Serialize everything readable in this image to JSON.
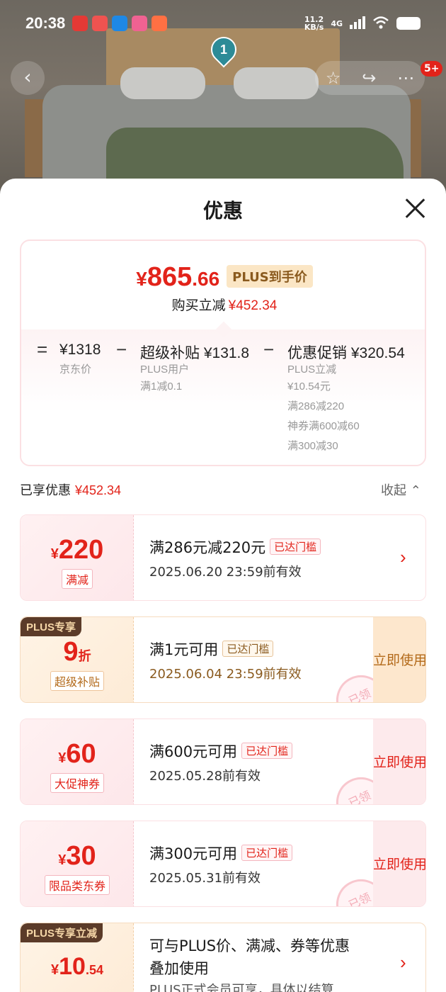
{
  "status_bar": {
    "time": "20:38",
    "net_speed_value": "11.2",
    "net_speed_unit": "KB/s",
    "network": "4G"
  },
  "header": {
    "location_pin": "1",
    "msg_badge": "5+"
  },
  "sheet": {
    "title": "优惠",
    "price": {
      "symbol": "¥",
      "integer": "865",
      "decimal": ".66",
      "plus_tag": "PLUS到手价",
      "buy_reduce_label": "购买立减",
      "buy_reduce_value": "¥452.34"
    },
    "breakdown": {
      "eq": "=",
      "minus": "−",
      "jd_price": {
        "value": "¥1318",
        "label": "京东价"
      },
      "super_subsidy": {
        "title": "超级补贴 ¥131.8",
        "lines": [
          "PLUS用户",
          "满1减0.1"
        ]
      },
      "promo": {
        "title": "优惠促销 ¥320.54",
        "lines": [
          "PLUS立减",
          "¥10.54元",
          "满286减220",
          "神券满600减60",
          "满300减30"
        ]
      }
    },
    "enjoyed": {
      "label": "已享优惠",
      "value": "¥452.34",
      "collapse": "收起"
    },
    "coupons": [
      {
        "symbol": "¥",
        "value": "220",
        "unit": "",
        "tag": "满减",
        "line1": "满286元减220元",
        "badge": "已达门槛",
        "line2": "2025.06.20 23:59前有效",
        "arrow": "›"
      },
      {
        "corner": "PLUS专享",
        "symbol": "",
        "value": "9",
        "unit": "折",
        "tag": "超级补贴",
        "line1": "满1元可用",
        "badge": "已达门槛",
        "line2": "2025.06.04 23:59前有效",
        "use": "立即使用",
        "stamp": "已领"
      },
      {
        "symbol": "¥",
        "value": "60",
        "unit": "",
        "tag": "大促神券",
        "line1": "满600元可用",
        "badge": "已达门槛",
        "line2": "2025.05.28前有效",
        "use": "立即使用",
        "stamp": "已领"
      },
      {
        "symbol": "¥",
        "value": "30",
        "unit": "",
        "tag": "限品类东券",
        "line1": "满300元可用",
        "badge": "已达门槛",
        "line2": "2025.05.31前有效",
        "use": "立即使用",
        "stamp": "已领"
      },
      {
        "corner": "PLUS专享立减",
        "symbol": "¥",
        "value": "10",
        "unit": ".54",
        "line1a": "可与PLUS价、满减、券等优惠",
        "line1b": "叠加使用",
        "line2": "PLUS正式会员可享，具体以结算…",
        "arrow": "›"
      }
    ]
  },
  "colors": {
    "accent_red": "#e2231a",
    "plus_brown": "#5b3b29",
    "plus_gold": "#fbe6c5"
  }
}
